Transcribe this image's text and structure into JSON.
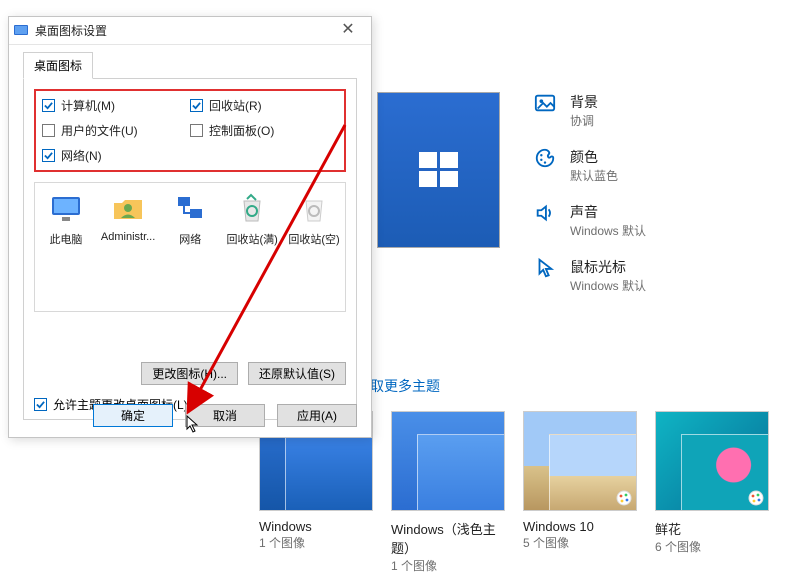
{
  "dialog": {
    "title": "桌面图标设置",
    "tab_label": "桌面图标",
    "checks": {
      "computer": {
        "label": "计算机(M)",
        "checked": true
      },
      "recycle": {
        "label": "回收站(R)",
        "checked": true
      },
      "user_files": {
        "label": "用户的文件(U)",
        "checked": false
      },
      "control_panel": {
        "label": "控制面板(O)",
        "checked": false
      },
      "network": {
        "label": "网络(N)",
        "checked": true
      }
    },
    "icons": [
      {
        "key": "this-pc",
        "label": "此电脑"
      },
      {
        "key": "admin",
        "label": "Administr..."
      },
      {
        "key": "network",
        "label": "网络"
      },
      {
        "key": "recycle-full",
        "label": "回收站(满)"
      },
      {
        "key": "recycle-empty",
        "label": "回收站(空)"
      }
    ],
    "btn_change_icon": "更改图标(H)...",
    "btn_restore": "还原默认值(S)",
    "allow_theme_label": "允许主题更改桌面图标(L)",
    "allow_theme_checked": true,
    "btn_ok": "确定",
    "btn_cancel": "取消",
    "btn_apply": "应用(A)"
  },
  "right": {
    "items": [
      {
        "key": "background",
        "title": "背景",
        "sub": "协调"
      },
      {
        "key": "color",
        "title": "颜色",
        "sub": "默认蓝色"
      },
      {
        "key": "sound",
        "title": "声音",
        "sub": "Windows 默认"
      },
      {
        "key": "cursor",
        "title": "鼠标光标",
        "sub": "Windows 默认"
      }
    ],
    "link_more": "取更多主题"
  },
  "themes": [
    {
      "key": "windows",
      "title": "Windows",
      "sub": "1 个图像",
      "variant": "blue"
    },
    {
      "key": "windows-light",
      "title": "Windows（浅色主题）",
      "sub": "1 个图像",
      "variant": "blue-light"
    },
    {
      "key": "windows-10",
      "title": "Windows 10",
      "sub": "5 个图像",
      "variant": "beach"
    },
    {
      "key": "fresh-flower",
      "title": "鲜花",
      "sub": "6 个图像",
      "variant": "teal"
    }
  ]
}
